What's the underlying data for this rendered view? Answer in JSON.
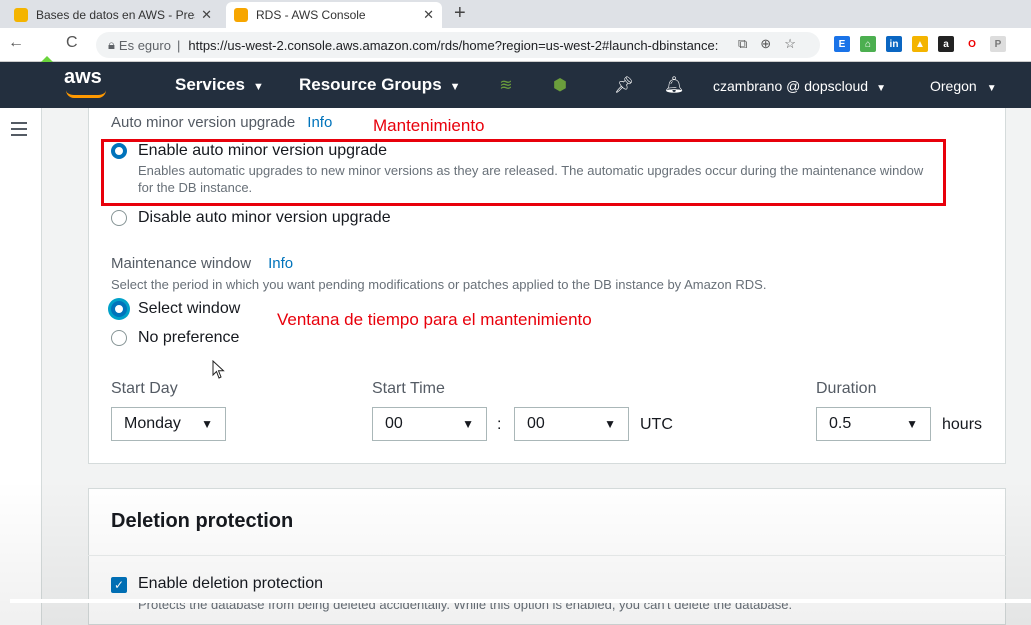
{
  "browser": {
    "tabs": [
      {
        "label": "Bases de datos en AWS - Present",
        "favicon_color": "#f4b400",
        "close": "✕"
      },
      {
        "label": "RDS - AWS Console",
        "favicon_color": "#f7a600",
        "close": "✕"
      }
    ],
    "new_tab": "+",
    "security_text": "Es eguro",
    "url": "https://us-west-2.console.aws.amazon.com/rds/home?region=us-west-2#launch-dbinstance:"
  },
  "aws_nav": {
    "logo": "aws",
    "services": "Services",
    "resource_groups": "Resource Groups",
    "user": "czambrano @ dopscloud",
    "region": "Oregon",
    "brand_color": "#232f3e",
    "accent_color": "#ff9900"
  },
  "auto_minor": {
    "label": "Auto minor version upgrade",
    "info": "Info",
    "enable_label": "Enable auto minor version upgrade",
    "enable_desc": "Enables automatic upgrades to new minor versions as they are released. The automatic upgrades occur during the maintenance window for the DB instance.",
    "disable_label": "Disable auto minor version upgrade"
  },
  "maintenance": {
    "label": "Maintenance window",
    "info": "Info",
    "desc": "Select the period in which you want pending modifications or patches applied to the DB instance by Amazon RDS.",
    "select_window": "Select window",
    "no_preference": "No preference",
    "start_day_label": "Start Day",
    "start_day_value": "Monday",
    "start_time_label": "Start Time",
    "start_hour": "00",
    "start_minute": "00",
    "colon": ":",
    "utc": "UTC",
    "duration_label": "Duration",
    "duration_value": "0.5",
    "hours": "hours"
  },
  "annotations": {
    "maintenance": "Mantenimiento",
    "window": "Ventana de tiempo para el mantenimiento",
    "color": "#e8000b"
  },
  "deletion": {
    "title": "Deletion protection",
    "checkbox_label": "Enable deletion protection",
    "desc": "Protects the database from being deleted accidentally. While this option is enabled, you can't delete the database."
  }
}
